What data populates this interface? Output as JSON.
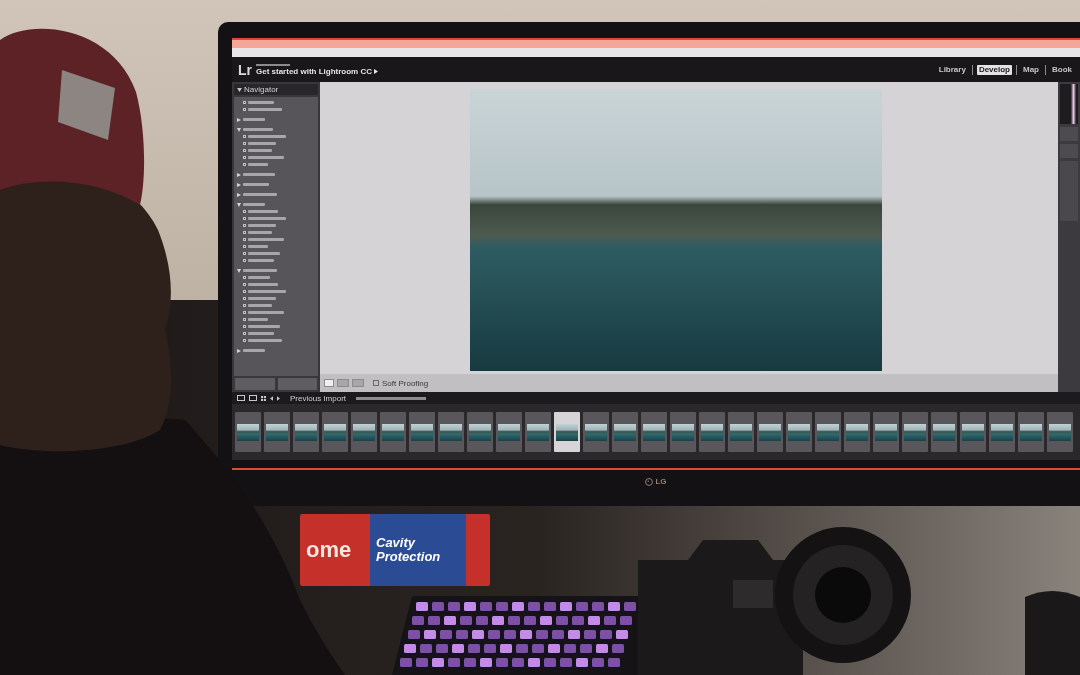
{
  "monitor": {
    "logo": "LG"
  },
  "app": {
    "logo": "Lr",
    "identity": "Get started with Lightroom CC",
    "modules": [
      {
        "label": "Library",
        "selected": false
      },
      {
        "label": "Develop",
        "selected": true
      },
      {
        "label": "Map",
        "selected": false
      },
      {
        "label": "Book",
        "selected": false
      }
    ],
    "left_panel": {
      "header": "Navigator",
      "tree": [
        {
          "kind": "preset"
        },
        {
          "kind": "preset"
        },
        {
          "kind": "folder",
          "expanded": false
        },
        {
          "kind": "folder",
          "expanded": true,
          "children": [
            {
              "kind": "preset"
            },
            {
              "kind": "preset"
            },
            {
              "kind": "preset"
            },
            {
              "kind": "preset"
            },
            {
              "kind": "preset"
            }
          ]
        },
        {
          "kind": "folder",
          "expanded": false
        },
        {
          "kind": "folder",
          "expanded": false
        },
        {
          "kind": "folder",
          "expanded": false
        },
        {
          "kind": "folder",
          "expanded": true,
          "children": [
            {
              "kind": "preset"
            },
            {
              "kind": "preset"
            },
            {
              "kind": "preset"
            },
            {
              "kind": "preset"
            },
            {
              "kind": "preset"
            },
            {
              "kind": "preset"
            },
            {
              "kind": "preset"
            },
            {
              "kind": "preset"
            }
          ]
        },
        {
          "kind": "folder",
          "expanded": true,
          "children": [
            {
              "kind": "preset"
            },
            {
              "kind": "preset"
            },
            {
              "kind": "preset"
            },
            {
              "kind": "preset"
            },
            {
              "kind": "preset"
            },
            {
              "kind": "preset"
            },
            {
              "kind": "preset"
            },
            {
              "kind": "preset"
            },
            {
              "kind": "preset"
            },
            {
              "kind": "preset"
            }
          ]
        },
        {
          "kind": "folder",
          "expanded": false
        }
      ]
    },
    "toolbar": {
      "soft_proofing": {
        "label": "Soft Proofing",
        "checked": false
      }
    },
    "filmstrip": {
      "source": "Previous Import",
      "thumbnails": [
        {
          "selected": false
        },
        {
          "selected": false
        },
        {
          "selected": false
        },
        {
          "selected": false
        },
        {
          "selected": false
        },
        {
          "selected": false
        },
        {
          "selected": false
        },
        {
          "selected": false
        },
        {
          "selected": false
        },
        {
          "selected": false
        },
        {
          "selected": false
        },
        {
          "selected": true
        },
        {
          "selected": false
        },
        {
          "selected": false
        },
        {
          "selected": false
        },
        {
          "selected": false
        },
        {
          "selected": false
        },
        {
          "selected": false
        },
        {
          "selected": false
        },
        {
          "selected": false
        },
        {
          "selected": false
        },
        {
          "selected": false
        },
        {
          "selected": false
        },
        {
          "selected": false
        },
        {
          "selected": false
        },
        {
          "selected": false
        },
        {
          "selected": false
        },
        {
          "selected": false
        },
        {
          "selected": false
        }
      ]
    }
  },
  "desk": {
    "product_box": {
      "partial_word": "ome",
      "label": "Cavity Protection"
    }
  }
}
